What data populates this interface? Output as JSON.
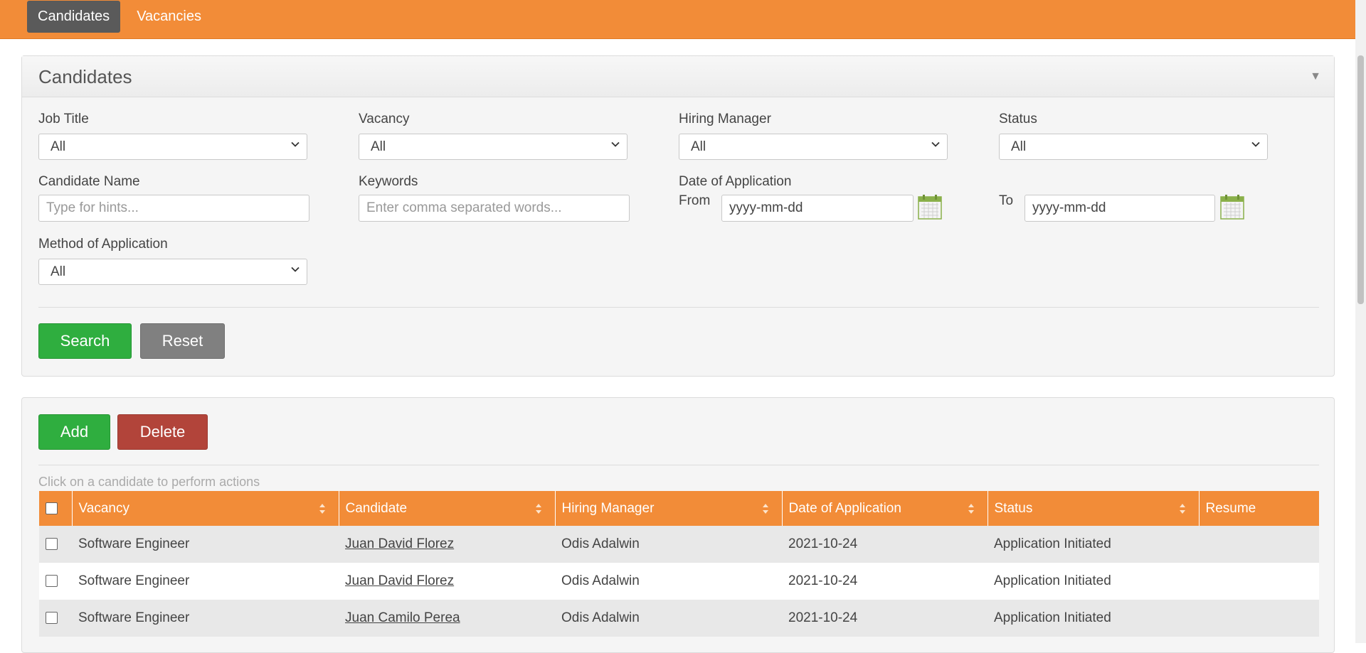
{
  "nav": {
    "items": [
      {
        "label": "Candidates"
      },
      {
        "label": "Vacancies"
      }
    ]
  },
  "search": {
    "title": "Candidates",
    "job_title": {
      "label": "Job Title",
      "value": "All"
    },
    "vacancy": {
      "label": "Vacancy",
      "value": "All"
    },
    "hiring_manager": {
      "label": "Hiring Manager",
      "value": "All"
    },
    "status": {
      "label": "Status",
      "value": "All"
    },
    "candidate_name": {
      "label": "Candidate Name",
      "placeholder": "Type for hints..."
    },
    "keywords": {
      "label": "Keywords",
      "placeholder": "Enter comma separated words..."
    },
    "date_of_application": {
      "label": "Date of Application",
      "from_label": "From",
      "to_label": "To",
      "from_value": "yyyy-mm-dd",
      "to_value": "yyyy-mm-dd"
    },
    "method": {
      "label": "Method of Application",
      "value": "All"
    },
    "search_label": "Search",
    "reset_label": "Reset"
  },
  "list": {
    "add_label": "Add",
    "delete_label": "Delete",
    "hint": "Click on a candidate to perform actions",
    "columns": [
      "Vacancy",
      "Candidate",
      "Hiring Manager",
      "Date of Application",
      "Status",
      "Resume"
    ],
    "rows": [
      {
        "vacancy": "Software Engineer",
        "candidate": "Juan David Florez",
        "manager": "Odis Adalwin",
        "date": "2021-10-24",
        "status": "Application Initiated",
        "resume": ""
      },
      {
        "vacancy": "Software Engineer",
        "candidate": "Juan David Florez",
        "manager": "Odis Adalwin",
        "date": "2021-10-24",
        "status": "Application Initiated",
        "resume": ""
      },
      {
        "vacancy": "Software Engineer",
        "candidate": "Juan Camilo Perea",
        "manager": "Odis Adalwin",
        "date": "2021-10-24",
        "status": "Application Initiated",
        "resume": ""
      }
    ]
  },
  "colors": {
    "accent": "#f28c38",
    "green": "#2fae3f",
    "red": "#b2443a",
    "gray": "#808080"
  }
}
